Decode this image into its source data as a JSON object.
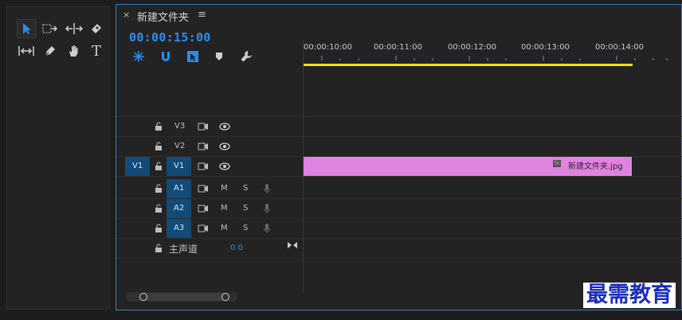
{
  "tools": [
    {
      "name": "selection-tool",
      "icon": "arrow-icon"
    },
    {
      "name": "track-select-tool",
      "icon": "track-select-icon"
    },
    {
      "name": "ripple-edit-tool",
      "icon": "ripple-edit-icon"
    },
    {
      "name": "razor-tool",
      "icon": "razor-icon"
    },
    {
      "name": "slip-tool",
      "icon": "slip-icon"
    },
    {
      "name": "pen-tool",
      "icon": "pen-icon"
    },
    {
      "name": "hand-tool",
      "icon": "hand-icon"
    },
    {
      "name": "type-tool",
      "icon": "type-icon"
    }
  ],
  "tools_type_glyph": "T",
  "timeline": {
    "tab_close": "×",
    "tab_title": "新建文件夹",
    "tab_menu": "≡",
    "timecode": "00:00:15:00",
    "ruler_labels": [
      "00:00:10:00",
      "00:00:11:00",
      "00:00:12:00",
      "00:00:13:00",
      "00:00:14:00"
    ],
    "marker_icon": "♦"
  },
  "tracks": {
    "video": [
      {
        "label": "V3"
      },
      {
        "label": "V2"
      },
      {
        "label": "V1",
        "source": "V1"
      }
    ],
    "audio": [
      {
        "label": "A1",
        "mute": "M",
        "solo": "S"
      },
      {
        "label": "A2",
        "mute": "M",
        "solo": "S"
      },
      {
        "label": "A3",
        "mute": "M",
        "solo": "S"
      }
    ],
    "master": {
      "label": "主声道",
      "value": "0.0"
    }
  },
  "clip": {
    "name": "新建文件夹.jpg",
    "fx": "fx",
    "color": "#e082e0"
  },
  "accent_color": "#2d8ceb",
  "playhead_bar_color": "#f0e400",
  "watermark": "最需教育"
}
